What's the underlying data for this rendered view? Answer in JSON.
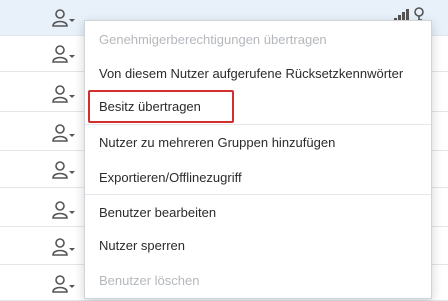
{
  "menu": {
    "items": [
      {
        "label": "Genehmigerberechtigungen übertragen",
        "disabled": true
      },
      {
        "label": "Von diesem Nutzer aufgerufene Rücksetzkennwörter",
        "disabled": false
      },
      {
        "label": "Besitz übertragen",
        "disabled": false,
        "highlighted": true
      },
      {
        "label": "Nutzer zu mehreren Gruppen hinzufügen",
        "disabled": false
      },
      {
        "label": "Exportieren/Offlinezugriff",
        "disabled": false
      },
      {
        "label": "Benutzer bearbeiten",
        "disabled": false
      },
      {
        "label": "Nutzer sperren",
        "disabled": false
      },
      {
        "label": "Benutzer löschen",
        "disabled": true
      }
    ]
  },
  "icons": {
    "row_action": "user-dropdown-icon",
    "corner": [
      "chart-icon",
      "key-icon"
    ]
  },
  "colors": {
    "highlight_border": "#d32f2f",
    "selected_row": "#e8f1fa",
    "disabled_text": "#b4b8bc"
  }
}
